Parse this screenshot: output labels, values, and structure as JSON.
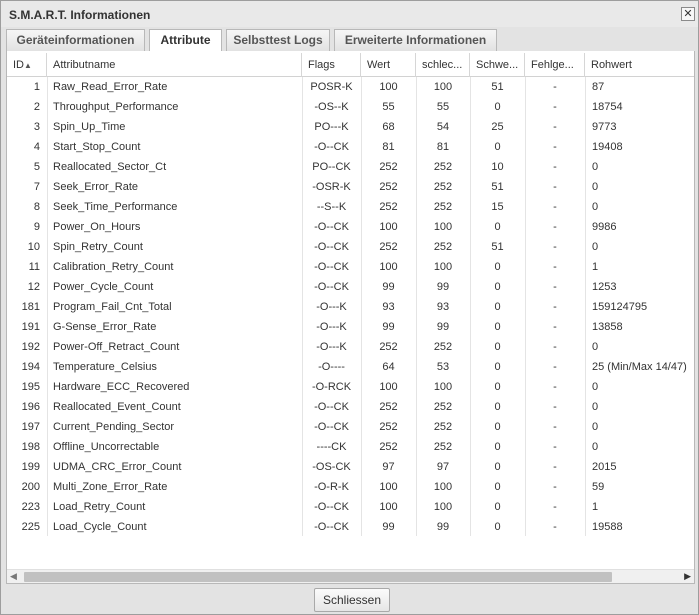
{
  "window": {
    "title": "S.M.A.R.T. Informationen"
  },
  "tabs": [
    {
      "label": "Geräteinformationen"
    },
    {
      "label": "Attribute"
    },
    {
      "label": "Selbsttest Logs"
    },
    {
      "label": "Erweiterte Informationen"
    }
  ],
  "active_tab": "Attribute",
  "table": {
    "columns": [
      "ID",
      "Attributname",
      "Flags",
      "Wert",
      "schlec...",
      "Schwe...",
      "Fehlge...",
      "Rohwert"
    ],
    "sort": {
      "column": "ID",
      "direction": "ascending"
    },
    "rows": [
      [
        "1",
        "Raw_Read_Error_Rate",
        "POSR-K",
        "100",
        "100",
        "51",
        "-",
        "87"
      ],
      [
        "2",
        "Throughput_Performance",
        "-OS--K",
        "55",
        "55",
        "0",
        "-",
        "18754"
      ],
      [
        "3",
        "Spin_Up_Time",
        "PO---K",
        "68",
        "54",
        "25",
        "-",
        "9773"
      ],
      [
        "4",
        "Start_Stop_Count",
        "-O--CK",
        "81",
        "81",
        "0",
        "-",
        "19408"
      ],
      [
        "5",
        "Reallocated_Sector_Ct",
        "PO--CK",
        "252",
        "252",
        "10",
        "-",
        "0"
      ],
      [
        "7",
        "Seek_Error_Rate",
        "-OSR-K",
        "252",
        "252",
        "51",
        "-",
        "0"
      ],
      [
        "8",
        "Seek_Time_Performance",
        "--S--K",
        "252",
        "252",
        "15",
        "-",
        "0"
      ],
      [
        "9",
        "Power_On_Hours",
        "-O--CK",
        "100",
        "100",
        "0",
        "-",
        "9986"
      ],
      [
        "10",
        "Spin_Retry_Count",
        "-O--CK",
        "252",
        "252",
        "51",
        "-",
        "0"
      ],
      [
        "11",
        "Calibration_Retry_Count",
        "-O--CK",
        "100",
        "100",
        "0",
        "-",
        "1"
      ],
      [
        "12",
        "Power_Cycle_Count",
        "-O--CK",
        "99",
        "99",
        "0",
        "-",
        "1253"
      ],
      [
        "181",
        "Program_Fail_Cnt_Total",
        "-O---K",
        "93",
        "93",
        "0",
        "-",
        "159124795"
      ],
      [
        "191",
        "G-Sense_Error_Rate",
        "-O---K",
        "99",
        "99",
        "0",
        "-",
        "13858"
      ],
      [
        "192",
        "Power-Off_Retract_Count",
        "-O---K",
        "252",
        "252",
        "0",
        "-",
        "0"
      ],
      [
        "194",
        "Temperature_Celsius",
        "-O----",
        "64",
        "53",
        "0",
        "-",
        "25 (Min/Max 14/47)"
      ],
      [
        "195",
        "Hardware_ECC_Recovered",
        "-O-RCK",
        "100",
        "100",
        "0",
        "-",
        "0"
      ],
      [
        "196",
        "Reallocated_Event_Count",
        "-O--CK",
        "252",
        "252",
        "0",
        "-",
        "0"
      ],
      [
        "197",
        "Current_Pending_Sector",
        "-O--CK",
        "252",
        "252",
        "0",
        "-",
        "0"
      ],
      [
        "198",
        "Offline_Uncorrectable",
        "----CK",
        "252",
        "252",
        "0",
        "-",
        "0"
      ],
      [
        "199",
        "UDMA_CRC_Error_Count",
        "-OS-CK",
        "97",
        "97",
        "0",
        "-",
        "2015"
      ],
      [
        "200",
        "Multi_Zone_Error_Rate",
        "-O-R-K",
        "100",
        "100",
        "0",
        "-",
        "59"
      ],
      [
        "223",
        "Load_Retry_Count",
        "-O--CK",
        "100",
        "100",
        "0",
        "-",
        "1"
      ],
      [
        "225",
        "Load_Cycle_Count",
        "-O--CK",
        "99",
        "99",
        "0",
        "-",
        "19588"
      ]
    ]
  },
  "footer": {
    "close_label": "Schliessen"
  },
  "icons": {
    "window_close": "close-icon",
    "sort": "sort-ascending-icon",
    "scroll_left": "arrow-left-icon",
    "scroll_right": "arrow-right-icon"
  }
}
